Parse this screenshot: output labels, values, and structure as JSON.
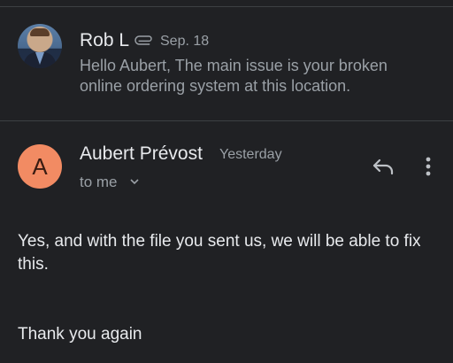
{
  "thread": {
    "collapsed_message": {
      "sender": "Rob L",
      "date": "Sep. 18",
      "snippet": "Hello Aubert, The main issue is your broken online ordering system at this location.",
      "has_attachment": true,
      "avatar_icon": "user-photo-avatar"
    },
    "expanded_message": {
      "sender": "Aubert Prévost",
      "avatar_letter": "A",
      "avatar_color": "#f28b63",
      "date": "Yesterday",
      "recipient_label": "to me",
      "body": [
        "Yes, and with the file you sent us, we will be able to fix this.",
        "Thank you again"
      ],
      "actions": {
        "reply_icon": "reply-icon",
        "more_icon": "more-vertical-icon"
      }
    }
  },
  "colors": {
    "background": "#202124",
    "divider": "#3c4043",
    "primary_text": "#e8eaed",
    "secondary_text": "#9aa0a6"
  }
}
